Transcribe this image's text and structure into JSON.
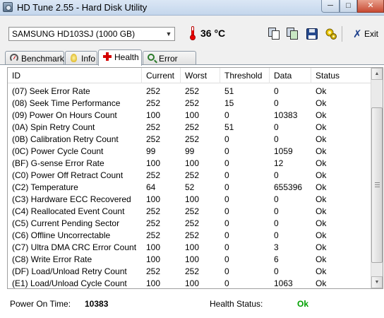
{
  "window": {
    "title": "HD Tune 2.55 - Hard Disk Utility",
    "min_glyph": "─",
    "max_glyph": "□",
    "close_glyph": "✕"
  },
  "toolbar": {
    "drive": "SAMSUNG HD103SJ (1000 GB)",
    "temperature": "36 °C",
    "exit_label": "Exit",
    "exit_glyph": "✗"
  },
  "tabs": [
    {
      "label": "Benchmark",
      "icon": "speedometer-icon",
      "active": false
    },
    {
      "label": "Info",
      "icon": "lightbulb-icon",
      "active": false
    },
    {
      "label": "Health",
      "icon": "red-cross-icon",
      "active": true
    },
    {
      "label": "Error Scan",
      "icon": "magnifier-icon",
      "active": false
    }
  ],
  "table": {
    "headers": [
      "ID",
      "Current",
      "Worst",
      "Threshold",
      "Data",
      "Status"
    ],
    "rows": [
      [
        "(07) Seek Error Rate",
        "252",
        "252",
        "51",
        "0",
        "Ok"
      ],
      [
        "(08) Seek Time Performance",
        "252",
        "252",
        "15",
        "0",
        "Ok"
      ],
      [
        "(09) Power On Hours Count",
        "100",
        "100",
        "0",
        "10383",
        "Ok"
      ],
      [
        "(0A) Spin Retry Count",
        "252",
        "252",
        "51",
        "0",
        "Ok"
      ],
      [
        "(0B) Calibration Retry Count",
        "252",
        "252",
        "0",
        "0",
        "Ok"
      ],
      [
        "(0C) Power Cycle Count",
        "99",
        "99",
        "0",
        "1059",
        "Ok"
      ],
      [
        "(BF) G-sense Error Rate",
        "100",
        "100",
        "0",
        "12",
        "Ok"
      ],
      [
        "(C0) Power Off Retract Count",
        "252",
        "252",
        "0",
        "0",
        "Ok"
      ],
      [
        "(C2) Temperature",
        "64",
        "52",
        "0",
        "655396",
        "Ok"
      ],
      [
        "(C3) Hardware ECC Recovered",
        "100",
        "100",
        "0",
        "0",
        "Ok"
      ],
      [
        "(C4) Reallocated Event Count",
        "252",
        "252",
        "0",
        "0",
        "Ok"
      ],
      [
        "(C5) Current Pending Sector",
        "252",
        "252",
        "0",
        "0",
        "Ok"
      ],
      [
        "(C6) Offline Uncorrectable",
        "252",
        "252",
        "0",
        "0",
        "Ok"
      ],
      [
        "(C7) Ultra DMA CRC Error Count",
        "100",
        "100",
        "0",
        "3",
        "Ok"
      ],
      [
        "(C8) Write Error Rate",
        "100",
        "100",
        "0",
        "6",
        "Ok"
      ],
      [
        "(DF) Load/Unload Retry Count",
        "252",
        "252",
        "0",
        "0",
        "Ok"
      ],
      [
        "(E1) Load/Unload Cycle Count",
        "100",
        "100",
        "0",
        "1063",
        "Ok"
      ]
    ]
  },
  "footer": {
    "power_on_time_label": "Power On Time:",
    "power_on_time_value": "10383",
    "health_status_label": "Health Status:",
    "health_status_value": "Ok"
  },
  "colors": {
    "health_ok": "#00a000",
    "title_bar": "#c4d6ec"
  }
}
